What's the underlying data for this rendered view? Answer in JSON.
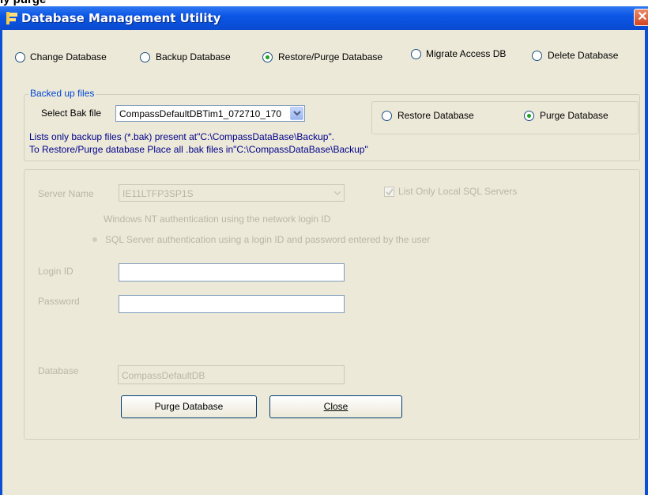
{
  "top_caption": "ly purge",
  "window": {
    "title": "Database Management Utility",
    "close_glyph": "✕"
  },
  "operations": [
    {
      "label": "Change Database",
      "selected": false
    },
    {
      "label": "Backup Database",
      "selected": false
    },
    {
      "label": "Restore/Purge Database",
      "selected": true
    },
    {
      "label": "Migrate Access DB",
      "selected": false
    },
    {
      "label": "Delete Database",
      "selected": false
    }
  ],
  "backup_group": {
    "legend": "Backed up files",
    "select_label": "Select Bak file",
    "selected_file": "CompassDefaultDBTim1_072710_170",
    "restore_option": "Restore Database",
    "purge_option": "Purge Database",
    "purge_selected": true,
    "info_line1": "Lists only backup files (*.bak) present at\"C:\\CompassDataBase\\Backup\".",
    "info_line2": "To Restore/Purge database Place all .bak files in\"C:\\CompassDataBase\\Backup\""
  },
  "server_group": {
    "server_name_label": "Server Name",
    "server_name_value": "IE11LTFP3SP1S",
    "list_local_label": "List Only Local SQL Servers",
    "list_local_checked": true,
    "windows_auth_label": "Windows NT authentication using the network login ID",
    "sql_auth_label": "SQL Server authentication using a login ID and password entered by the user",
    "login_label": "Login ID",
    "login_value": "",
    "password_label": "Password",
    "password_value": "",
    "database_label": "Database",
    "database_value": "CompassDefaultDB"
  },
  "buttons": {
    "purge": "Purge Database",
    "close": "Close"
  },
  "colors": {
    "titlebar": "#0b56e6",
    "window_bg": "#ece9d8",
    "legend_text": "#0046d5",
    "info_text": "#00008b",
    "radio_dot": "#21a121"
  }
}
